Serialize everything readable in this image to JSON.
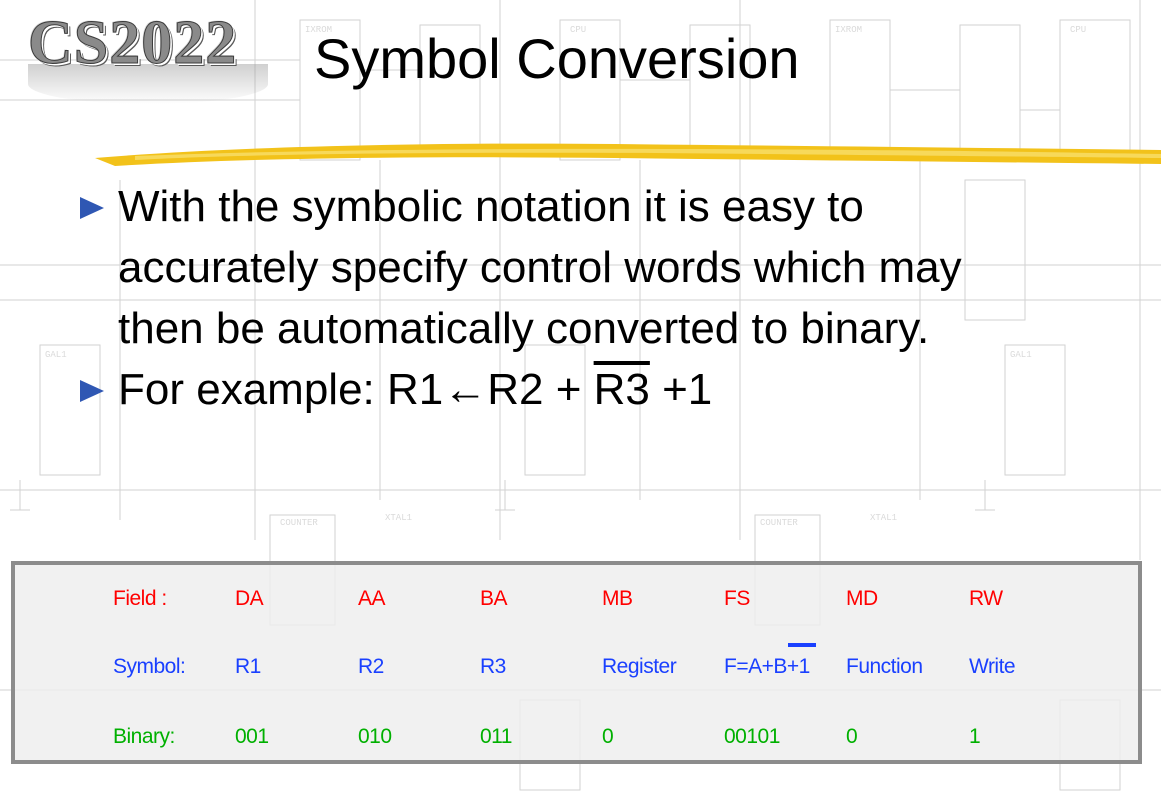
{
  "slide": {
    "logo": "CS2022",
    "title": "Symbol Conversion",
    "bullets": [
      {
        "lines": [
          "With the symbolic notation it is easy to",
          "accurately specify control words which may",
          "then be automatically converted to binary."
        ]
      },
      {
        "prefix": "For example: R1",
        "arrow": "←",
        "mid": "R2 + ",
        "overlined": "R3",
        "suffix": " +1"
      }
    ]
  },
  "control_word": {
    "field": [
      "Field :",
      "DA",
      "AA",
      "BA",
      "MB",
      "FS",
      "MD",
      "RW"
    ],
    "symbol": [
      "Symbol:",
      "R1",
      "R2",
      "R3",
      "Register",
      "F=A+B+1",
      "Function",
      "Write"
    ],
    "binary": [
      "Binary:",
      "001",
      "010",
      "011",
      "0",
      "00101",
      "0",
      "1"
    ]
  },
  "colors": {
    "field": "#ff0000",
    "symbol": "#1a40ff",
    "binary": "#00b000",
    "bullet": "#2f57b3",
    "highlight": "#f2c21a"
  }
}
